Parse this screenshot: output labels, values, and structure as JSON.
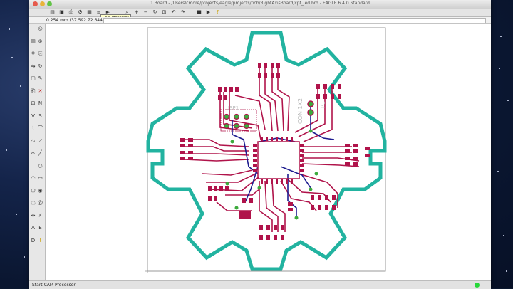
{
  "window": {
    "title": "1 Board - /Users/cmore/projects/eagle/projects/pcb/RightAxisBoard/cpt_led.brd - EAGLE 6.4.0 Standard"
  },
  "toolbar": {
    "tooltip": "CAM Processor"
  },
  "coordbar": {
    "readout": "0.254 mm (37.592 72.644)",
    "command_value": ""
  },
  "board": {
    "labels": {
      "isp": "ISP1",
      "conn": "CON 1X2",
      "p1": "P1"
    },
    "colors": {
      "outline": "#22b3a0",
      "top_traces": "#b0134a",
      "bottom_traces": "#1d1b8f",
      "pads": "#b0134a",
      "vias": "#3caa3c"
    }
  },
  "statusbar": {
    "text": "Start CAM Processor"
  },
  "icons": {
    "toolbar": [
      "open-icon",
      "save-icon",
      "print-icon",
      "cam-processor-icon",
      "board-icon",
      "script-icon",
      "run-icon",
      "zoom-fit-icon",
      "zoom-in-icon",
      "zoom-out-icon",
      "redraw-icon",
      "zoom-select-icon",
      "undo-icon",
      "redo-icon",
      "stop-icon",
      "go-icon",
      "help-icon"
    ],
    "left": [
      "info-icon",
      "show-icon",
      "display-icon",
      "mark-icon",
      "move-icon",
      "copy-icon",
      "mirror-icon",
      "rotate-icon",
      "group-icon",
      "change-icon",
      "paste-icon",
      "delete-icon",
      "add-icon",
      "name-icon",
      "value-icon",
      "smash-icon",
      "split-icon",
      "miter-icon",
      "optimize-icon",
      "route-icon",
      "ripup-icon",
      "wire-icon",
      "text-icon",
      "circle-icon",
      "arc-icon",
      "rect-icon",
      "polygon-icon",
      "via-icon",
      "hole-icon",
      "attribute-icon",
      "dimension-icon",
      "ratsnest-icon",
      "auto-icon",
      "erc-icon",
      "drc-icon",
      "errors-icon"
    ]
  }
}
